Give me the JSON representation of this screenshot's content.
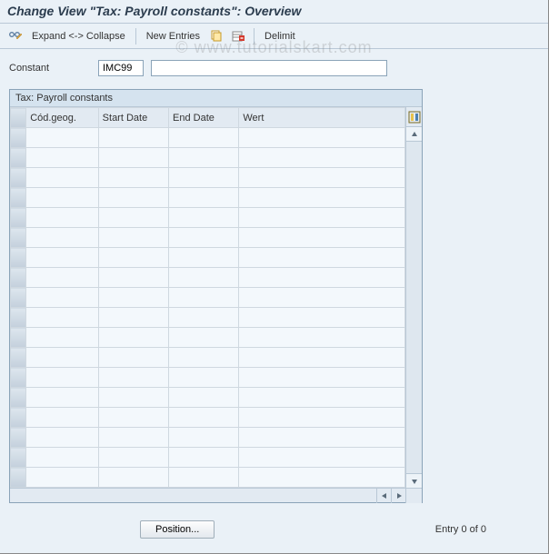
{
  "title": "Change View \"Tax: Payroll constants\": Overview",
  "toolbar": {
    "expand_collapse": "Expand <-> Collapse",
    "new_entries": "New Entries",
    "delimit": "Delimit",
    "icons": {
      "edit": "pencil-glasses-icon",
      "copy": "copy-icon",
      "delete": "delete-row-icon"
    }
  },
  "watermark": "© www.tutorialskart.com",
  "field": {
    "label": "Constant",
    "code": "IMC99",
    "description": ""
  },
  "grid": {
    "title": "Tax: Payroll constants",
    "columns": [
      "Cód.geog.",
      "Start Date",
      "End Date",
      "Wert"
    ],
    "rows": [
      [
        "",
        "",
        "",
        ""
      ],
      [
        "",
        "",
        "",
        ""
      ],
      [
        "",
        "",
        "",
        ""
      ],
      [
        "",
        "",
        "",
        ""
      ],
      [
        "",
        "",
        "",
        ""
      ],
      [
        "",
        "",
        "",
        ""
      ],
      [
        "",
        "",
        "",
        ""
      ],
      [
        "",
        "",
        "",
        ""
      ],
      [
        "",
        "",
        "",
        ""
      ],
      [
        "",
        "",
        "",
        ""
      ],
      [
        "",
        "",
        "",
        ""
      ],
      [
        "",
        "",
        "",
        ""
      ],
      [
        "",
        "",
        "",
        ""
      ],
      [
        "",
        "",
        "",
        ""
      ],
      [
        "",
        "",
        "",
        ""
      ],
      [
        "",
        "",
        "",
        ""
      ],
      [
        "",
        "",
        "",
        ""
      ],
      [
        "",
        "",
        "",
        ""
      ]
    ]
  },
  "footer": {
    "position_btn": "Position...",
    "entry_status": "Entry 0 of 0"
  }
}
